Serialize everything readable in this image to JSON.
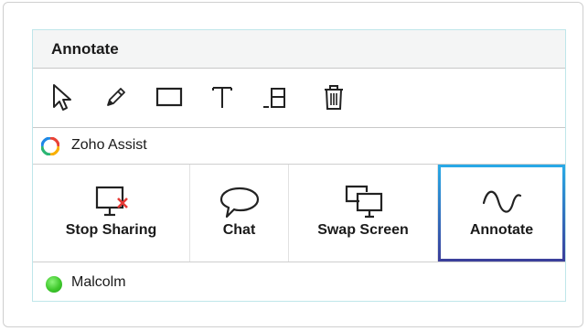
{
  "panel": {
    "title": "Annotate"
  },
  "toolbar": {
    "tools": [
      {
        "name": "select",
        "icon": "cursor-arrow-icon"
      },
      {
        "name": "pencil",
        "icon": "pencil-icon"
      },
      {
        "name": "rectangle",
        "icon": "rectangle-icon"
      },
      {
        "name": "text",
        "icon": "text-icon"
      },
      {
        "name": "layout",
        "icon": "layout-icon"
      },
      {
        "name": "delete",
        "icon": "trash-icon"
      }
    ]
  },
  "app": {
    "name": "Zoho Assist",
    "logo_colors": [
      "#e94235",
      "#f9b000",
      "#2bb673",
      "#1e88e5"
    ]
  },
  "actions": [
    {
      "label": "Stop Sharing",
      "icon": "stop-sharing-monitor-icon",
      "selected": false
    },
    {
      "label": "Chat",
      "icon": "chat-bubble-icon",
      "selected": false
    },
    {
      "label": "Swap Screen",
      "icon": "swap-screen-icon",
      "selected": false
    },
    {
      "label": "Annotate",
      "icon": "annotate-wave-icon",
      "selected": true
    }
  ],
  "user": {
    "name": "Malcolm",
    "status_color": "#3fc82c"
  },
  "colors": {
    "selected_border_top": "#29a9e6",
    "selected_border_bottom": "#3b3f9b",
    "stop_sharing_x": "#e53935"
  }
}
